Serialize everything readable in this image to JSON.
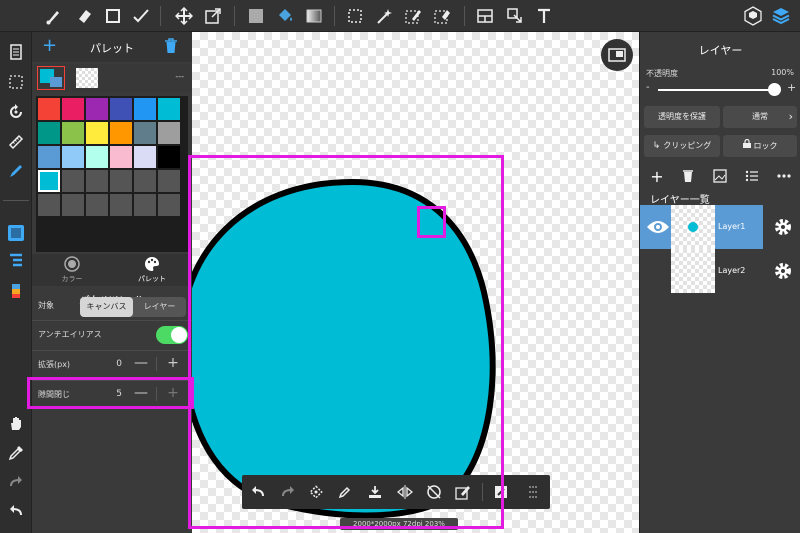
{
  "palette": {
    "title": "パレット",
    "swatch_label": "---",
    "cells": [
      "#f44336",
      "#e91e63",
      "#9c27b0",
      "#3f51b5",
      "#2196f3",
      "#00bcd4",
      "#009688",
      "#8bc34a",
      "#ffeb3b",
      "#ff9800",
      "#607d8b",
      "#9e9e9e",
      "#5b9bd5",
      "#90caf9",
      "#b2ffee",
      "#f8bbd0",
      "#dadcf5",
      "#000000",
      "#00bcd4",
      "#555555",
      "#555555",
      "#555555",
      "#555555",
      "#555555",
      "#555555",
      "#555555",
      "#555555",
      "#555555",
      "#555555",
      "#555555"
    ],
    "tabs": [
      {
        "label": "カラー"
      },
      {
        "label": "パレット"
      }
    ]
  },
  "bucket_tool": {
    "title": "バケツツール",
    "target": {
      "label": "対象",
      "options": [
        "キャンバス",
        "レイヤー"
      ],
      "selected": "キャンバス"
    },
    "antialias": {
      "label": "アンチエイリアス",
      "on": true
    },
    "expand": {
      "label": "拡張(px)",
      "value": "0",
      "minus": "—",
      "plus": "+"
    },
    "gap_close": {
      "label": "隙間閉じ",
      "value": "5",
      "minus": "—",
      "plus": "+"
    }
  },
  "layers_panel": {
    "title": "レイヤー",
    "opacity_label": "不透明度",
    "opacity_value": "100%",
    "opacity_fraction": 1.0,
    "slider_minus": "-",
    "slider_plus": "+",
    "protect_alpha": "透明度を保護",
    "blend_mode": "通常",
    "clipping": "クリッピング",
    "lock": "ロック",
    "list_title": "レイヤー一覧",
    "layers": [
      {
        "name": "Layer1",
        "selected": true
      },
      {
        "name": "Layer2",
        "selected": false
      }
    ]
  },
  "canvas": {
    "fill_color": "#00bcd4",
    "status": "2000*2000px 72dpi 203%"
  },
  "colors": {
    "accent": "#5b9bd5",
    "highlight": "#e21be0",
    "toggle_on": "#4cd964"
  }
}
